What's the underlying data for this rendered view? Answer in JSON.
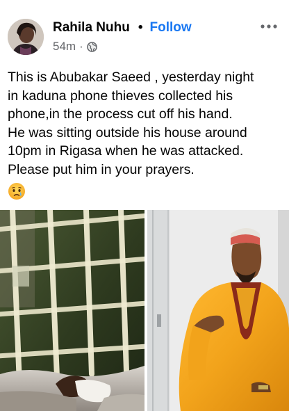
{
  "post": {
    "author_name": "Rahila Nuhu",
    "separator": "•",
    "follow_label": "Follow",
    "timestamp": "54m",
    "meta_separator": "·",
    "privacy_icon": "globe-icon",
    "more_icon": "more-horizontal-icon",
    "text_lines": [
      "This is Abubakar Saeed , yesterday night",
      "in kaduna phone thieves collected his",
      "phone,in the process cut off his hand.",
      "He was sitting outside his house around",
      "10pm in Rigasa when he was attacked.",
      "Please put him in your prayers."
    ],
    "emoji": "crying-face-emoji"
  },
  "colors": {
    "follow": "#1877f2",
    "meta": "#65676b",
    "text": "#050505",
    "robe": "#f2a31b"
  }
}
